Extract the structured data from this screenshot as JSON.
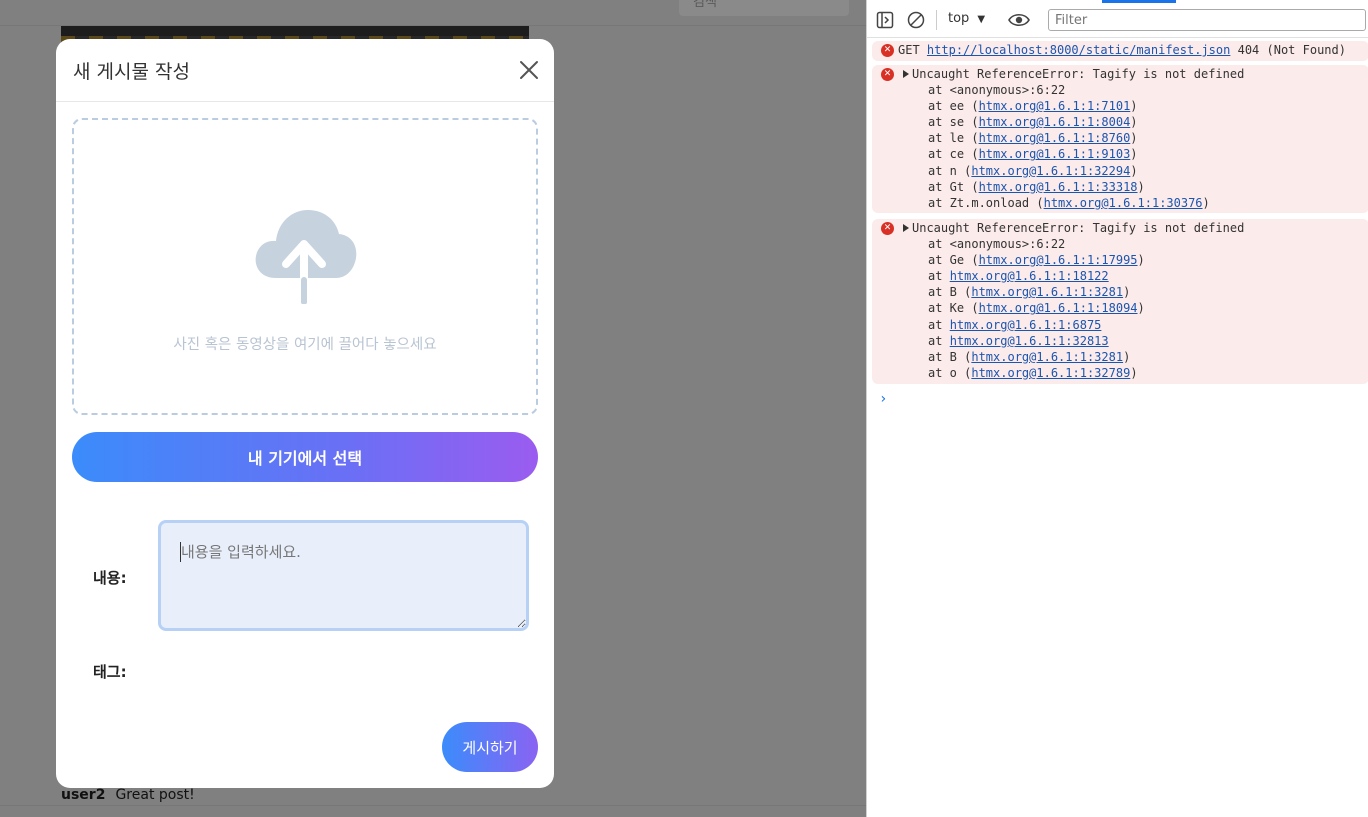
{
  "background_page": {
    "search_peek": "검색",
    "comment": {
      "user": "user2",
      "text": "Great post!"
    }
  },
  "modal": {
    "title": "새 게시물 작성",
    "close_icon": "close-icon",
    "dropzone": {
      "icon": "cloud-upload-icon",
      "hint": "사진 혹은 동영상을 여기에 끌어다 놓으세요"
    },
    "select_button": "내 기기에서 선택",
    "content_label": "내용:",
    "content_placeholder": "내용을 입력하세요.",
    "tags_label": "태그:",
    "post_button": "게시하기"
  },
  "devtools": {
    "toolbar": {
      "context": "top",
      "filter_placeholder": "Filter"
    },
    "entries": [
      {
        "method": "GET",
        "url": "http://localhost:8000/static/manifest.json",
        "status": "404 (Not Found)"
      },
      {
        "message": "Uncaught ReferenceError: Tagify is not defined",
        "stack": [
          {
            "prefix": "at <anonymous>:6:22",
            "link": "",
            "suffix": ""
          },
          {
            "prefix": "at ee (",
            "link": "htmx.org@1.6.1:1:7101",
            "suffix": ")"
          },
          {
            "prefix": "at se (",
            "link": "htmx.org@1.6.1:1:8004",
            "suffix": ")"
          },
          {
            "prefix": "at le (",
            "link": "htmx.org@1.6.1:1:8760",
            "suffix": ")"
          },
          {
            "prefix": "at ce (",
            "link": "htmx.org@1.6.1:1:9103",
            "suffix": ")"
          },
          {
            "prefix": "at n (",
            "link": "htmx.org@1.6.1:1:32294",
            "suffix": ")"
          },
          {
            "prefix": "at Gt (",
            "link": "htmx.org@1.6.1:1:33318",
            "suffix": ")"
          },
          {
            "prefix": "at Zt.m.onload (",
            "link": "htmx.org@1.6.1:1:30376",
            "suffix": ")"
          }
        ]
      },
      {
        "message": "Uncaught ReferenceError: Tagify is not defined",
        "stack": [
          {
            "prefix": "at <anonymous>:6:22",
            "link": "",
            "suffix": ""
          },
          {
            "prefix": "at Ge (",
            "link": "htmx.org@1.6.1:1:17995",
            "suffix": ")"
          },
          {
            "prefix": "at ",
            "link": "htmx.org@1.6.1:1:18122",
            "suffix": ""
          },
          {
            "prefix": "at B (",
            "link": "htmx.org@1.6.1:1:3281",
            "suffix": ")"
          },
          {
            "prefix": "at Ke (",
            "link": "htmx.org@1.6.1:1:18094",
            "suffix": ")"
          },
          {
            "prefix": "at ",
            "link": "htmx.org@1.6.1:1:6875",
            "suffix": ""
          },
          {
            "prefix": "at ",
            "link": "htmx.org@1.6.1:1:32813",
            "suffix": ""
          },
          {
            "prefix": "at B (",
            "link": "htmx.org@1.6.1:1:3281",
            "suffix": ")"
          },
          {
            "prefix": "at o (",
            "link": "htmx.org@1.6.1:1:32789",
            "suffix": ")"
          }
        ]
      }
    ],
    "prompt_symbol": "›"
  }
}
